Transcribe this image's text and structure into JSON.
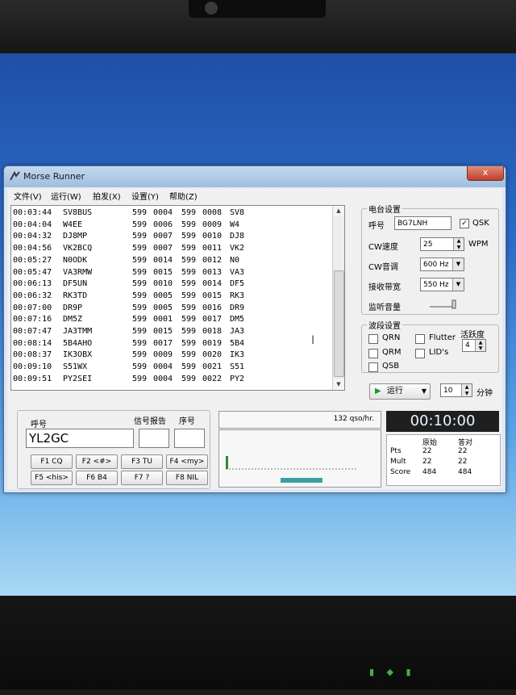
{
  "window": {
    "title": "Morse Runner",
    "close_label": "x"
  },
  "menu": {
    "items": [
      "文件(V)",
      "运行(W)",
      "拍发(X)",
      "设置(Y)",
      "帮助(Z)"
    ]
  },
  "log": {
    "rows": [
      [
        "00:03:44",
        "SV8BUS",
        "599",
        "0004",
        "599",
        "0008",
        "SV8"
      ],
      [
        "00:04:04",
        "W4EE",
        "599",
        "0006",
        "599",
        "0009",
        "W4"
      ],
      [
        "00:04:32",
        "DJ8MP",
        "599",
        "0007",
        "599",
        "0010",
        "DJ8"
      ],
      [
        "00:04:56",
        "VK2BCQ",
        "599",
        "0007",
        "599",
        "0011",
        "VK2"
      ],
      [
        "00:05:27",
        "N0ODK",
        "599",
        "0014",
        "599",
        "0012",
        "N0"
      ],
      [
        "00:05:47",
        "VA3RMW",
        "599",
        "0015",
        "599",
        "0013",
        "VA3"
      ],
      [
        "00:06:13",
        "DF5UN",
        "599",
        "0010",
        "599",
        "0014",
        "DF5"
      ],
      [
        "00:06:32",
        "RK3TD",
        "599",
        "0005",
        "599",
        "0015",
        "RK3"
      ],
      [
        "00:07:00",
        "DR9P",
        "599",
        "0005",
        "599",
        "0016",
        "DR9"
      ],
      [
        "00:07:16",
        "DM5Z",
        "599",
        "0001",
        "599",
        "0017",
        "DM5"
      ],
      [
        "00:07:47",
        "JA3TMM",
        "599",
        "0015",
        "599",
        "0018",
        "JA3"
      ],
      [
        "00:08:14",
        "5B4AHO",
        "599",
        "0017",
        "599",
        "0019",
        "5B4"
      ],
      [
        "00:08:37",
        "IK3OBX",
        "599",
        "0009",
        "599",
        "0020",
        "IK3"
      ],
      [
        "00:09:10",
        "S51WX",
        "599",
        "0004",
        "599",
        "0021",
        "S51"
      ],
      [
        "00:09:51",
        "PY2SEI",
        "599",
        "0004",
        "599",
        "0022",
        "PY2"
      ]
    ]
  },
  "station": {
    "group_title": "电台设置",
    "call_label": "呼号",
    "call_value": "BG7LNH",
    "qsk_label": "QSK",
    "qsk_checked": "✓",
    "speed_label": "CW速度",
    "speed_value": "25",
    "speed_unit": "WPM",
    "pitch_label": "CW音调",
    "pitch_value": "600 Hz",
    "bandwidth_label": "接收带宽",
    "bandwidth_value": "550 Hz",
    "monitor_label": "监听音量"
  },
  "band": {
    "group_title": "波段设置",
    "qrn": "QRN",
    "flutter": "Flutter",
    "qrm": "QRM",
    "lids": "LID's",
    "qsb": "QSB",
    "activity_label": "活跃度",
    "activity_value": "4"
  },
  "run": {
    "button_label": "运行",
    "minutes_value": "10",
    "minutes_unit": "分钟"
  },
  "entry": {
    "call_label": "呼号",
    "call_value": "YL2GC",
    "rst_label": "信号报告",
    "nr_label": "序号",
    "fkeys": [
      "F1 CQ",
      "F2 <#>",
      "F3 TU",
      "F4 <my>",
      "F5 <his>",
      "F6 B4",
      "F7 ?",
      "F8 NIL"
    ]
  },
  "scope": {
    "rate_text": "132 qso/hr."
  },
  "clock": {
    "time": "00:10:00"
  },
  "score": {
    "header_raw": "原始",
    "header_verified": "答对",
    "rows": [
      [
        "Pts",
        "22",
        "22"
      ],
      [
        "Mult",
        "22",
        "22"
      ],
      [
        "Score",
        "484",
        "484"
      ]
    ]
  }
}
